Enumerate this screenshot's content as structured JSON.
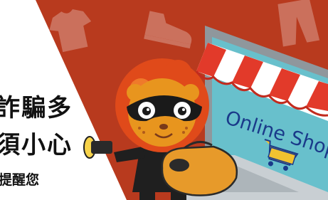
{
  "banner": {
    "headline_line1": "詐騙多",
    "headline_line2": "須小心",
    "subline": "提醒您",
    "screen_text": "Online Shop"
  },
  "colors": {
    "background": "#b83a1e",
    "background_dark": "#9c2c14",
    "panel": "#ffffff",
    "awning_red": "#e23a2a",
    "screen": "#68c0cc",
    "laptop": "#8f979c",
    "mascot_fur": "#e8951e",
    "mascot_mane": "#e04a1a",
    "bag": "#e79a2a"
  },
  "icons": [
    "tshirt-icon",
    "shoe-icon",
    "pants-icon",
    "shopping-cart-icon",
    "flashlight-icon"
  ]
}
